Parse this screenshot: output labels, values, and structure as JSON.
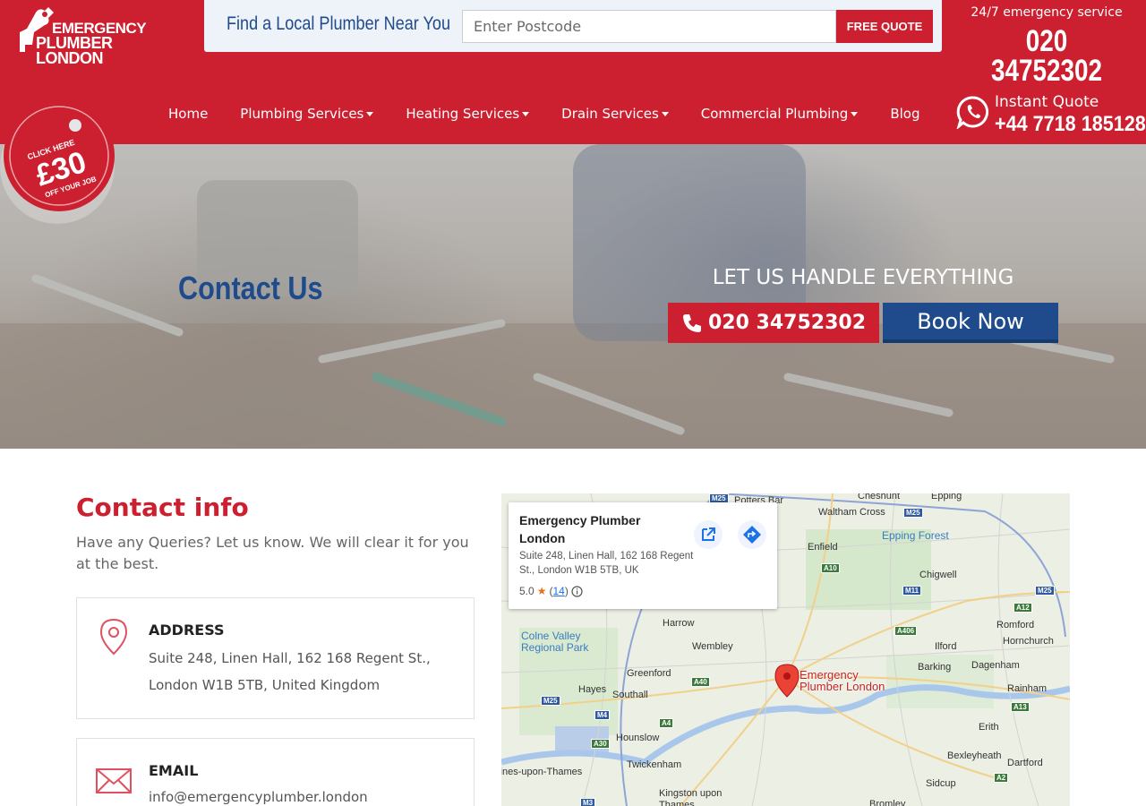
{
  "header": {
    "logo_line1": "EMERGENCY",
    "logo_line2": "PLUMBER LONDON",
    "search_title": "Find a Local Plumber Near You",
    "postcode_placeholder": "Enter Postcode",
    "quote_button": "FREE QUOTE",
    "emergency_label": "24/7 emergency service",
    "emergency_phone": "020 34752302",
    "whatsapp_label": "Instant Quote",
    "whatsapp_phone": "+44 7718 185128",
    "colors": {
      "brand_red": "#cc1f2f",
      "brand_blue": "#1f4b8c"
    }
  },
  "nav": {
    "items": [
      {
        "label": "Home",
        "dropdown": false
      },
      {
        "label": "Plumbing Services",
        "dropdown": true
      },
      {
        "label": "Heating Services",
        "dropdown": true
      },
      {
        "label": "Drain Services",
        "dropdown": true
      },
      {
        "label": "Commercial Plumbing",
        "dropdown": true
      },
      {
        "label": "Blog",
        "dropdown": false
      }
    ]
  },
  "badge": {
    "line1": "CLICK HERE",
    "amount": "£30",
    "line2": "OFF YOUR JOB"
  },
  "hero": {
    "title": "Contact Us",
    "tagline": "LET US HANDLE EVERYTHING",
    "call_button": "020 34752302",
    "book_button": "Book Now"
  },
  "contact": {
    "title": "Contact info",
    "description": "Have any Queries? Let us know. We will clear it for you at the best.",
    "address_heading": "ADDRESS",
    "address": "Suite 248, Linen Hall, 162 168 Regent St., London W1B 5TB, United Kingdom",
    "email_heading": "EMAIL",
    "email": "info@emergencyplumber.london"
  },
  "map": {
    "place_name": "Emergency Plumber London",
    "place_address": "Suite 248, Linen Hall, 162 168 Regent St., London W1B 5TB, UK",
    "rating": "5.0",
    "review_count": "14",
    "pin_label": "Emergency Plumber London",
    "labels": {
      "potters_bar": "Potters Bar",
      "cheshunt": "Cheshunt",
      "epping": "Epping",
      "waltham_cross": "Waltham Cross",
      "epping_forest": "Epping Forest",
      "enfield": "Enfield",
      "chigwell": "Chigwell",
      "romford": "Romford",
      "hornchurch": "Hornchurch",
      "harrow": "Harrow",
      "colne_valley": "Colne Valley Regional Park",
      "wembley": "Wembley",
      "ilford": "Ilford",
      "barking": "Barking",
      "dagenham": "Dagenham",
      "greenford": "Greenford",
      "hayes": "Hayes",
      "southall": "Southall",
      "rainham": "Rainham",
      "erith": "Erith",
      "hounslow": "Hounslow",
      "twickenham": "Twickenham",
      "bexleyheath": "Bexleyheath",
      "dartford": "Dartford",
      "sidcup": "Sidcup",
      "kingston": "Kingston upon Thames",
      "staines": "Staines-upon-Thames",
      "bromley": "Bromley"
    },
    "roads": {
      "m25a": "M25",
      "m25b": "M25",
      "m25c": "M25",
      "m25d": "M25",
      "a10": "A10",
      "m11": "M11",
      "a12": "A12",
      "a406": "A406",
      "a40": "A40",
      "m4": "M4",
      "a4": "A4",
      "a30": "A30",
      "a13": "A13",
      "a2": "A2",
      "m3": "M3"
    }
  }
}
